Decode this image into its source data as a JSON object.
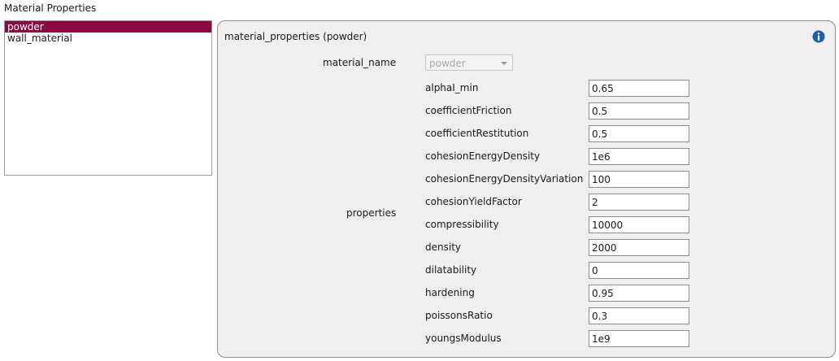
{
  "section_title": "Material Properties",
  "materials_list": [
    "powder",
    "wall_material"
  ],
  "selected_material": "powder",
  "panel": {
    "title": "material_properties (powder)",
    "info_icon": "info-icon",
    "material_name_label": "material_name",
    "material_name_value": "powder",
    "properties_label": "properties",
    "properties": [
      {
        "name": "alphaI_min",
        "value": "0.65"
      },
      {
        "name": "coefficientFriction",
        "value": "0.5"
      },
      {
        "name": "coefficientRestitution",
        "value": "0.5"
      },
      {
        "name": "cohesionEnergyDensity",
        "value": "1e6"
      },
      {
        "name": "cohesionEnergyDensityVariation",
        "value": "100"
      },
      {
        "name": "cohesionYieldFactor",
        "value": "2"
      },
      {
        "name": "compressibility",
        "value": "10000"
      },
      {
        "name": "density",
        "value": "2000"
      },
      {
        "name": "dilatability",
        "value": "0"
      },
      {
        "name": "hardening",
        "value": "0.95"
      },
      {
        "name": "poissonsRatio",
        "value": "0.3"
      },
      {
        "name": "youngsModulus",
        "value": "1e9"
      }
    ]
  },
  "colors": {
    "selection": "#8b0a43",
    "panel_bg": "#efefef",
    "info_icon": "#1f5fa8"
  }
}
